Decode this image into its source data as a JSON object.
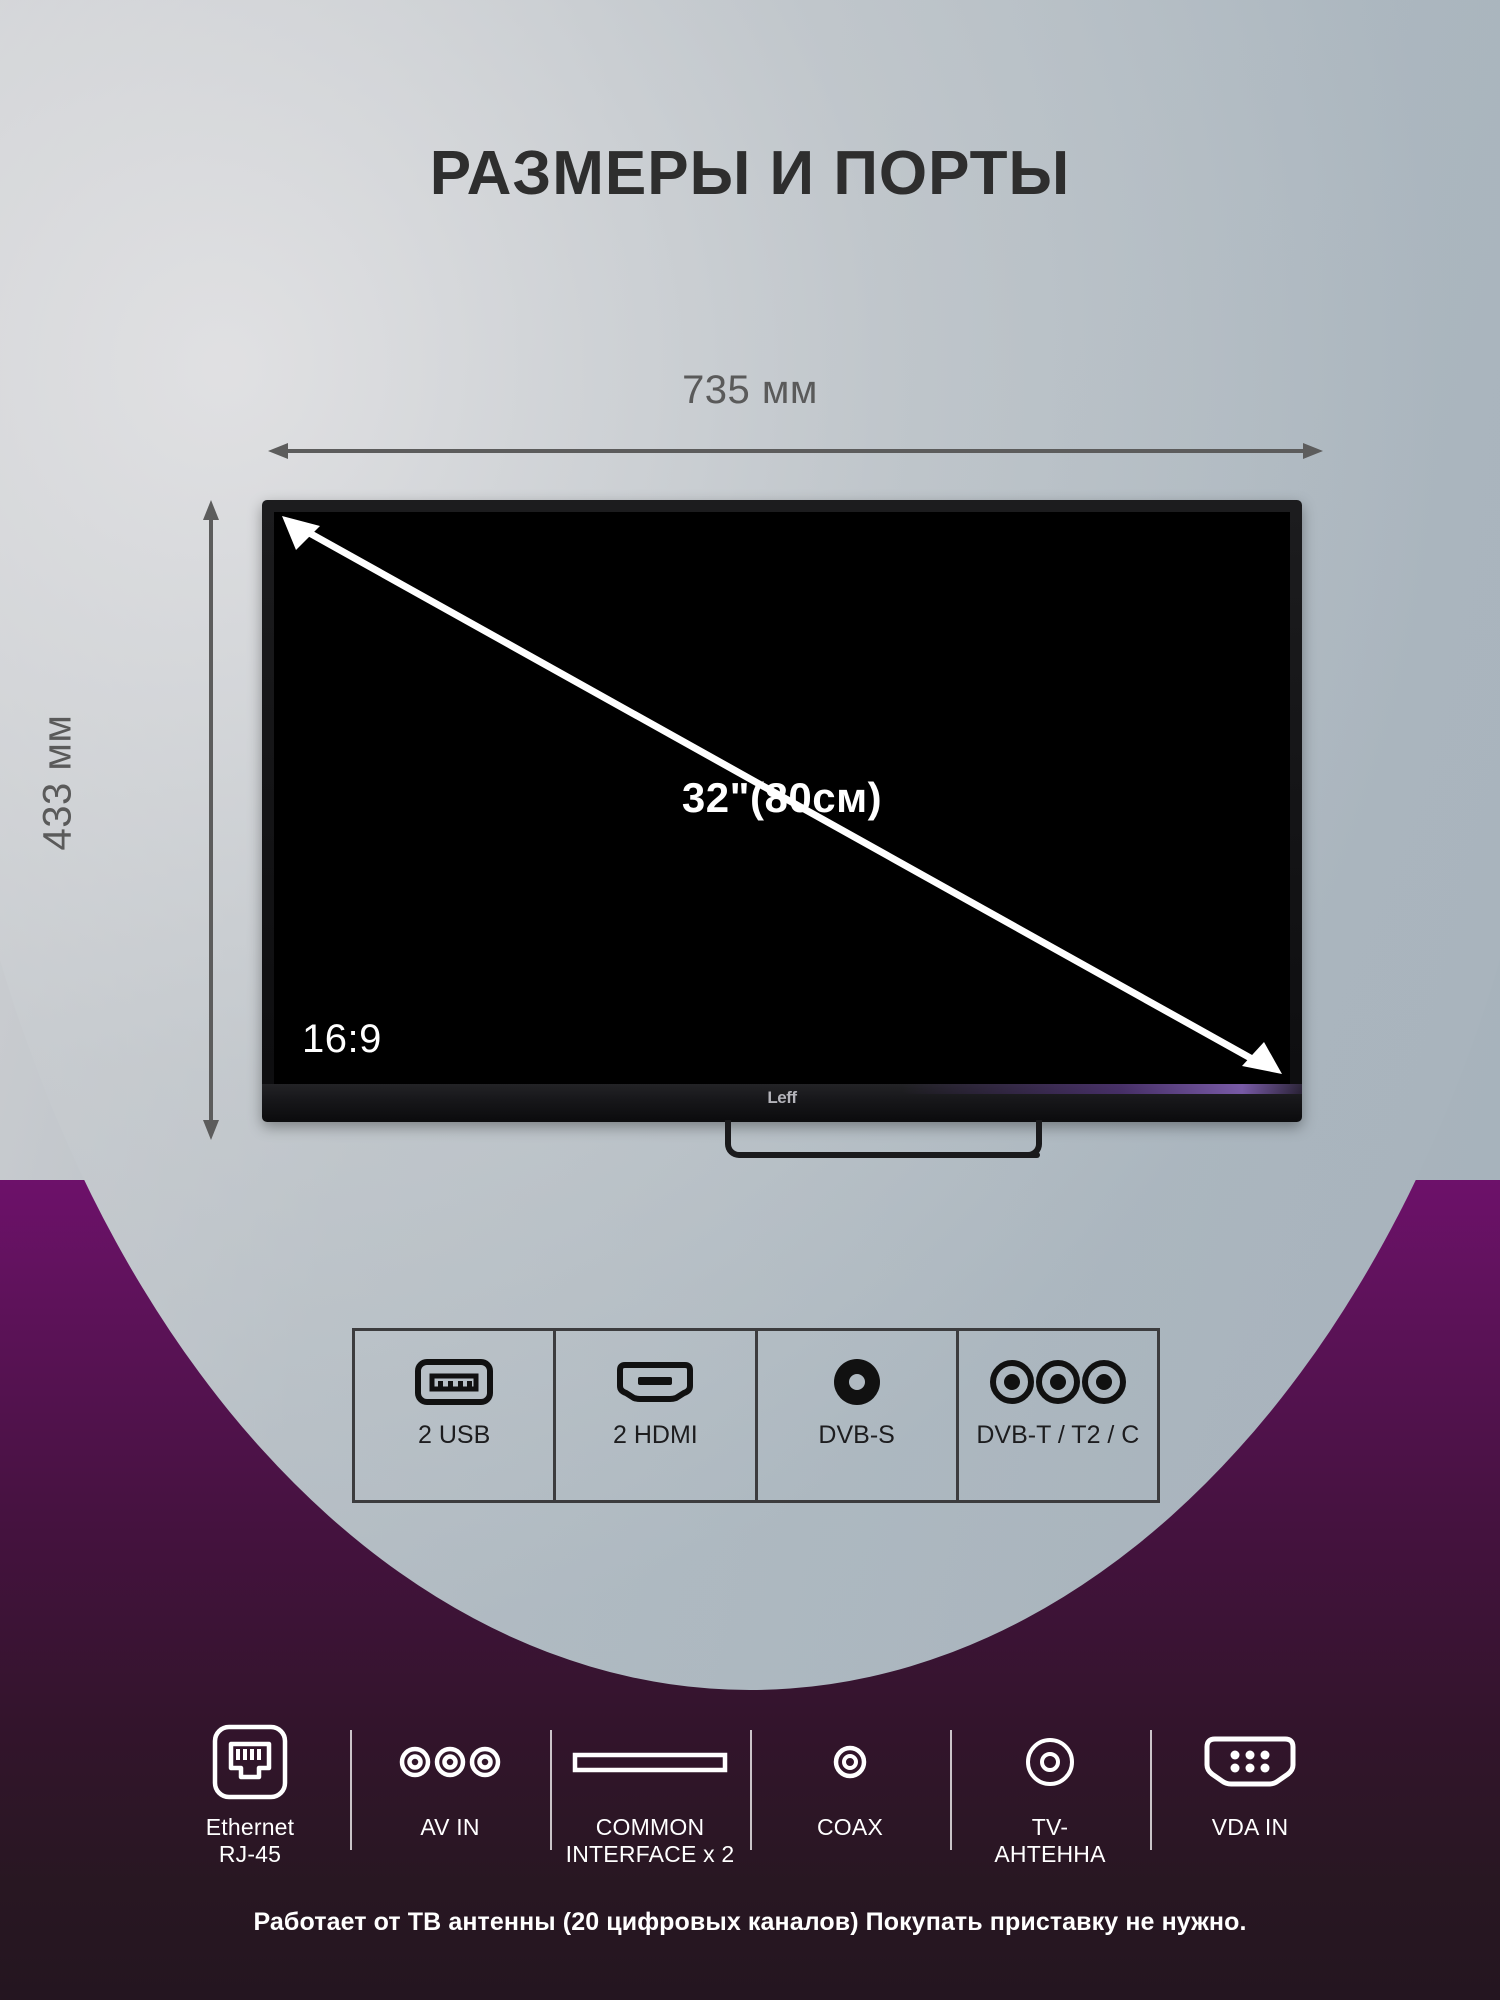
{
  "page": {
    "title": "РАЗМЕРЫ И ПОРТЫ",
    "background_grey": "#b0bac2",
    "background_purple": "#6d116a"
  },
  "dimensions": {
    "width_label": "735 мм",
    "height_label": "433 мм",
    "diagonal_label": "32\"(80см)",
    "aspect_label": "16:9"
  },
  "tv": {
    "brand_logo": "Leff"
  },
  "ports_table": {
    "cells": [
      {
        "icon": "usb-port-icon",
        "label": "2 USB"
      },
      {
        "icon": "hdmi-port-icon",
        "label": "2 HDMI"
      },
      {
        "icon": "dvb-s-satellite-jack-icon",
        "label": "DVB-S"
      },
      {
        "icon": "dvb-t-triple-jack-icon",
        "label": "DVB-T / T2 / C"
      }
    ]
  },
  "bottom_ports": {
    "items": [
      {
        "icon": "ethernet-rj45-icon",
        "label": "Ethernet\nRJ-45",
        "line1": "Ethernet",
        "line2": "RJ-45"
      },
      {
        "icon": "av-in-rca-icon",
        "label": "AV IN",
        "line1": "AV IN",
        "line2": ""
      },
      {
        "icon": "common-interface-slot-icon",
        "label": "COMMON INTERFACE x 2",
        "line1": "COMMON",
        "line2": "INTERFACE x 2"
      },
      {
        "icon": "coax-jack-icon",
        "label": "COAX",
        "line1": "COAX",
        "line2": ""
      },
      {
        "icon": "tv-antenna-jack-icon",
        "label": "TV-АНТЕННА",
        "line1": "TV-",
        "line2": "АНТЕННА"
      },
      {
        "icon": "vga-port-icon",
        "label": "VDA IN",
        "line1": "VDA IN",
        "line2": ""
      }
    ]
  },
  "footer": {
    "text": "Работает от ТВ антенны (20 цифровых каналов) Покупать приставку не нужно."
  }
}
